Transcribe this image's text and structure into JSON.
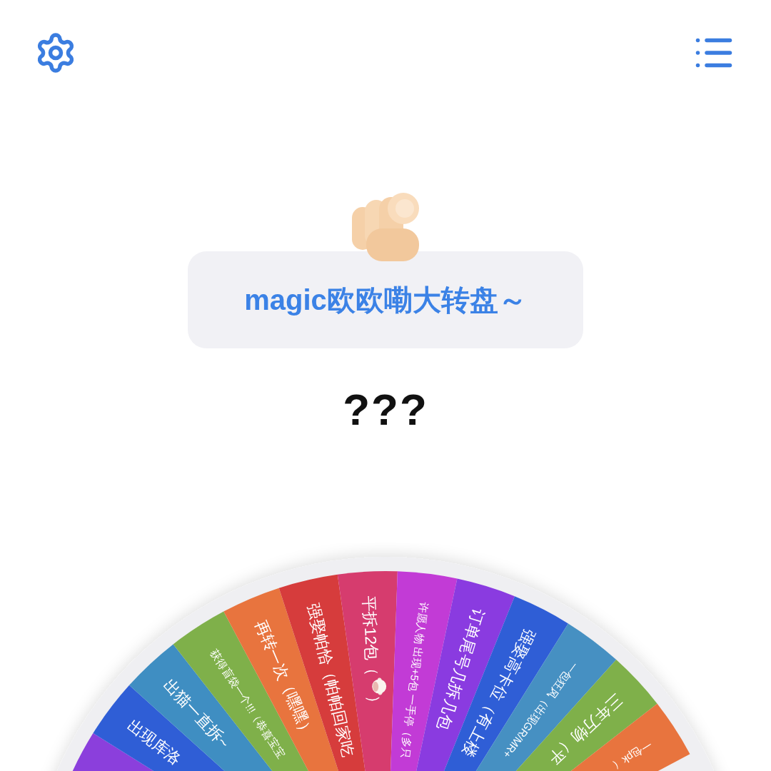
{
  "title": "magic欧欧嘞大转盘～",
  "result": "???",
  "wheel": {
    "segments": [
      {
        "color": "#8b3fdc",
        "kind": "blank"
      },
      {
        "color": "#2f5ed6",
        "label": "出现库洛",
        "kind": "large"
      },
      {
        "color": "#3f8ec2",
        "label": "出猫一直拆~",
        "kind": "large"
      },
      {
        "color": "#7fb04a",
        "label": "获得盲袋一个!!!（恭喜宝宝",
        "kind": "small"
      },
      {
        "color": "#e8743e",
        "label": "再转一次（嘿嘿）",
        "kind": "large"
      },
      {
        "color": "#d63c3c",
        "label": "强娶帕恰（帕帕回家吃",
        "kind": "large"
      },
      {
        "color": "#d63c6e",
        "label": "平拆12包（",
        "label_after": "）",
        "kind": "emoji"
      },
      {
        "color": "#c23bd6",
        "label": "许愿人物 出现+5包 一手停（多只",
        "kind": "small"
      },
      {
        "color": "#8a3be0",
        "label": "订单尾号几拆几包",
        "kind": "large"
      },
      {
        "color": "#2f5ed6",
        "label": "强娶高卡位（有上楼",
        "kind": "large"
      },
      {
        "color": "#4690c2",
        "label": "一包狂风（出现GR/MR+",
        "kind": "small"
      },
      {
        "color": "#7fb04a",
        "label": "三年万物（平",
        "kind": "large"
      },
      {
        "color": "#e8743e",
        "label": "一包pk（",
        "kind": "small"
      }
    ]
  }
}
